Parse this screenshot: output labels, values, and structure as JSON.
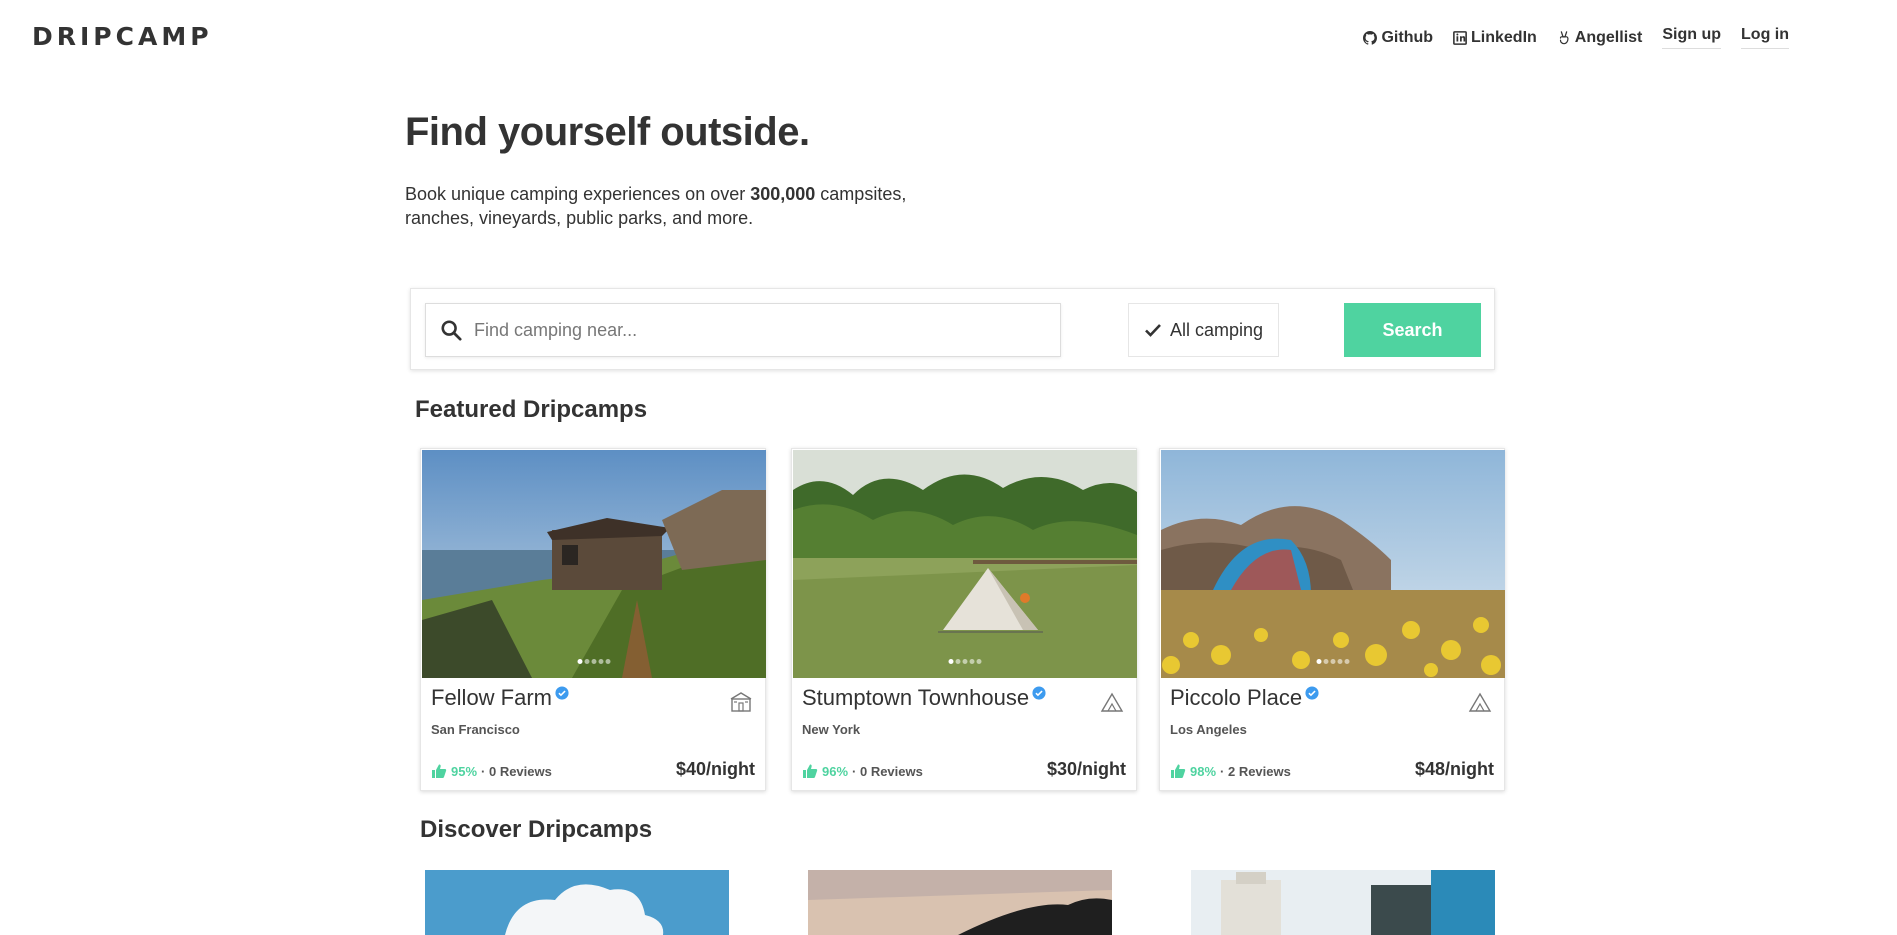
{
  "header": {
    "logo": "DRIPCAMP",
    "nav": {
      "github": "Github",
      "linkedin": "LinkedIn",
      "angellist": "Angellist",
      "signup": "Sign up",
      "login": "Log in"
    }
  },
  "hero": {
    "title": "Find yourself outside.",
    "subtitle_pre": "Book unique camping experiences on over ",
    "subtitle_bold": "300,000",
    "subtitle_post": " campsites, ranches, vineyards, public parks, and more."
  },
  "search": {
    "placeholder": "Find camping near...",
    "filter_label": "All camping",
    "button_label": "Search"
  },
  "featured": {
    "title": "Featured Dripcamps",
    "cards": [
      {
        "name": "Fellow Farm",
        "location": "San Francisco",
        "rating": "95%",
        "reviews": "· 0 Reviews",
        "price": "$40/night",
        "type_icon": "cabin-icon"
      },
      {
        "name": "Stumptown Townhouse",
        "location": "New York",
        "rating": "96%",
        "reviews": "· 0 Reviews",
        "price": "$30/night",
        "type_icon": "tent-icon"
      },
      {
        "name": "Piccolo Place",
        "location": "Los Angeles",
        "rating": "98%",
        "reviews": "· 2 Reviews",
        "price": "$48/night",
        "type_icon": "tent-icon"
      }
    ]
  },
  "discover": {
    "title": "Discover Dripcamps"
  },
  "colors": {
    "accent": "#4fd3a0",
    "text": "#333333",
    "verified": "#3d9bef"
  }
}
